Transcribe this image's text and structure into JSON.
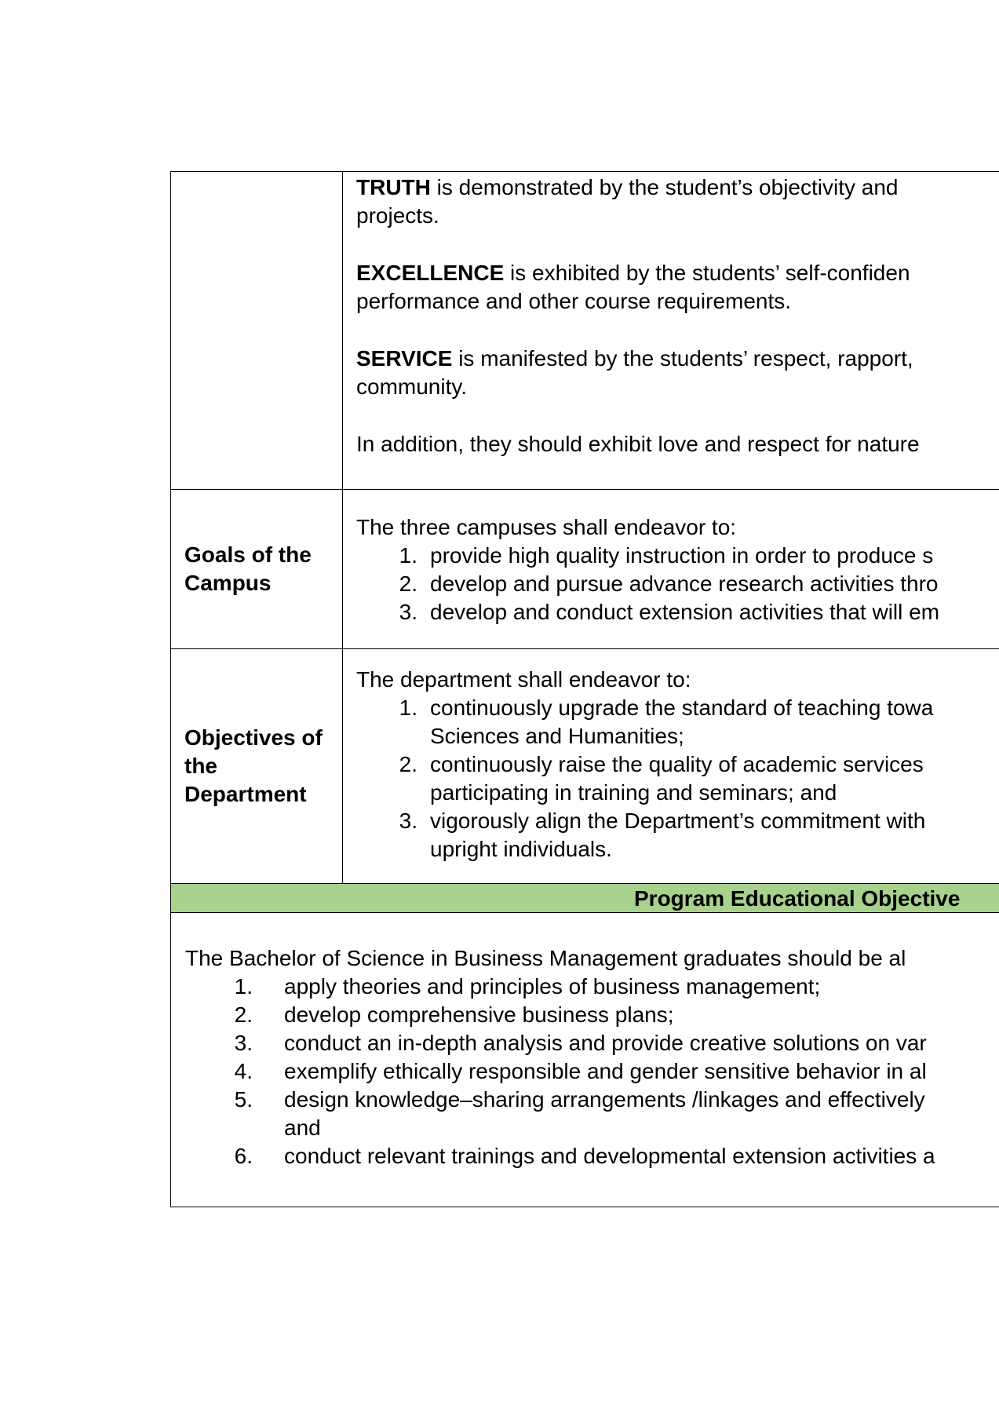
{
  "values_row": {
    "paragraphs": [
      {
        "bold": "TRUTH",
        "rest": " is demonstrated by the student’s objectivity and",
        "line2": "projects."
      },
      {
        "bold": "EXCELLENCE",
        "rest": " is exhibited by the students’ self-confiden",
        "line2": "performance and other course requirements."
      },
      {
        "bold": "SERVICE",
        "rest": " is manifested by the students’ respect, rapport,",
        "line2": "community."
      },
      {
        "bold": "",
        "rest": "In addition, they should exhibit love and respect for nature",
        "line2": ""
      }
    ]
  },
  "goals_row": {
    "label": "Goals of the Campus",
    "intro": "The three campuses shall endeavor to:",
    "items": [
      {
        "num": "1.",
        "text": "provide high quality instruction in order to produce s"
      },
      {
        "num": "2.",
        "text": "develop and pursue advance research activities thro"
      },
      {
        "num": "3.",
        "text": "develop and conduct extension activities that will em"
      }
    ]
  },
  "objectives_row": {
    "label": "Objectives of the Department",
    "intro": "The department shall endeavor to:",
    "items": [
      {
        "num": "1.",
        "line1": "continuously upgrade the standard of teaching towa",
        "line2": "Sciences and Humanities;"
      },
      {
        "num": "2.",
        "line1": "continuously raise the quality of academic services",
        "line2": "participating in training and seminars; and"
      },
      {
        "num": "3.",
        "line1": "vigorously align the Department’s commitment with",
        "line2": "upright individuals."
      }
    ]
  },
  "peo": {
    "header": "Program Educational Objective",
    "intro": "The Bachelor of Science in Business Management graduates should be al",
    "items": [
      {
        "num": "1.",
        "line1": "apply theories and principles of business management;",
        "line2": ""
      },
      {
        "num": "2.",
        "line1": "develop comprehensive business plans;",
        "line2": ""
      },
      {
        "num": "3.",
        "line1": "conduct an in-depth analysis and provide creative solutions on var",
        "line2": ""
      },
      {
        "num": "4.",
        "line1": "exemplify ethically responsible and gender sensitive behavior in al",
        "line2": ""
      },
      {
        "num": "5.",
        "line1": "design knowledge–sharing arrangements /linkages and effectively",
        "line2": "and"
      },
      {
        "num": "6.",
        "line1": "conduct relevant trainings and developmental extension activities a",
        "line2": ""
      }
    ]
  },
  "colors": {
    "header_bg": "#a9d18e"
  }
}
